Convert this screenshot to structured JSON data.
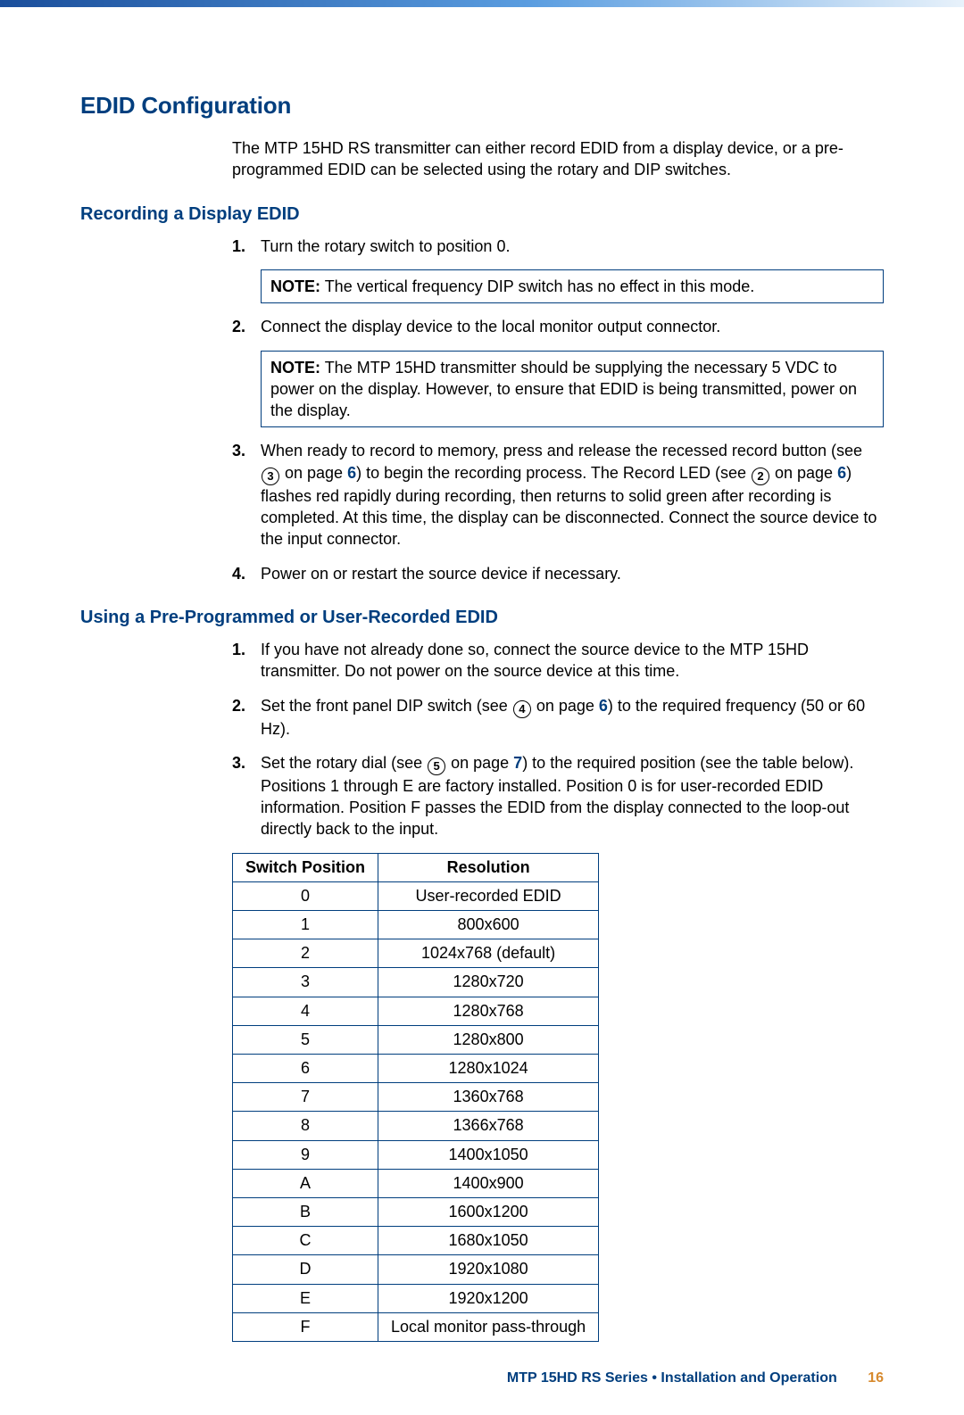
{
  "header": {
    "title": "EDID Configuration"
  },
  "intro": "The MTP 15HD RS transmitter can either record EDID from a display device, or a pre-programmed EDID can be selected using the rotary and DIP switches.",
  "record": {
    "title": "Recording a Display EDID",
    "step1": {
      "num": "1.",
      "text": "Turn the rotary switch to position 0."
    },
    "note1": {
      "label": "NOTE:",
      "text": "The vertical frequency DIP switch has no effect in this mode."
    },
    "step2": {
      "num": "2.",
      "text": "Connect the display device to the local monitor output connector."
    },
    "note2": {
      "label": "NOTE:",
      "text": "The MTP 15HD transmitter should be supplying the necessary 5 VDC to power on the display. However, to ensure that EDID is being transmitted, power on the display."
    },
    "step3": {
      "num": "3.",
      "part1": "When ready to record to memory, press and release the recessed record button (see ",
      "ref1": "3",
      "part2": " on page ",
      "pageA": "6",
      "part3": ") to begin the recording process. The Record LED (see ",
      "ref2": "2",
      "part4": " on page ",
      "pageB": "6",
      "part5": ") flashes red rapidly during recording, then returns to solid green after recording is completed. At this time, the display can be disconnected. Connect the source device to the input connector."
    },
    "step4": {
      "num": "4.",
      "text": "Power on or restart the source device if necessary."
    }
  },
  "preprog": {
    "title": "Using a Pre-Programmed or User-Recorded EDID",
    "step1": {
      "num": "1.",
      "text": "If you have not already done so, connect the source device to the MTP 15HD transmitter. Do not power on the source device at this time."
    },
    "step2": {
      "num": "2.",
      "part1": "Set the front panel DIP switch (see ",
      "ref": "4",
      "part2": " on page ",
      "page": "6",
      "part3": ") to the required frequency (50 or 60 Hz)."
    },
    "step3": {
      "num": "3.",
      "part1": "Set the rotary dial (see ",
      "ref": "5",
      "part2": " on page ",
      "page": "7",
      "part3": ") to the required position (see the table below). Positions 1 through E are factory installed. Position 0 is for user-recorded EDID information. Position F passes the EDID from the display connected to the loop-out directly back to the input."
    }
  },
  "table": {
    "h1": "Switch Position",
    "h2": "Resolution",
    "rows": [
      {
        "pos": "0",
        "res": "User-recorded EDID"
      },
      {
        "pos": "1",
        "res": "800x600"
      },
      {
        "pos": "2",
        "res": "1024x768 (default)"
      },
      {
        "pos": "3",
        "res": "1280x720"
      },
      {
        "pos": "4",
        "res": "1280x768"
      },
      {
        "pos": "5",
        "res": "1280x800"
      },
      {
        "pos": "6",
        "res": "1280x1024"
      },
      {
        "pos": "7",
        "res": "1360x768"
      },
      {
        "pos": "8",
        "res": "1366x768"
      },
      {
        "pos": "9",
        "res": "1400x1050"
      },
      {
        "pos": "A",
        "res": "1400x900"
      },
      {
        "pos": "B",
        "res": "1600x1200"
      },
      {
        "pos": "C",
        "res": "1680x1050"
      },
      {
        "pos": "D",
        "res": "1920x1080"
      },
      {
        "pos": "E",
        "res": "1920x1200"
      },
      {
        "pos": "F",
        "res": "Local monitor pass-through"
      }
    ]
  },
  "footer": {
    "text": "MTP 15HD RS Series • Installation and Operation",
    "page": "16"
  }
}
